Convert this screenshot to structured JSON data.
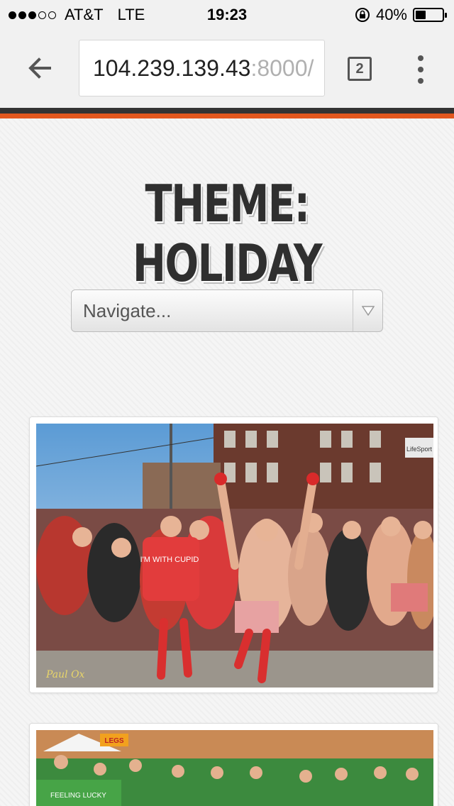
{
  "status_bar": {
    "carrier": "AT&T",
    "network": "LTE",
    "time": "19:23",
    "battery": "40%",
    "battery_level": 0.4
  },
  "browser": {
    "url_host": "104.239.139.43",
    "url_rest": ":8000/",
    "tab_count": "2",
    "icons": [
      "back-arrow-icon",
      "tabs-icon",
      "overflow-menu-icon"
    ]
  },
  "page": {
    "title": "THEME: HOLIDAY",
    "nav_select_value": "Navigate...",
    "photos": [
      {
        "shirt_text": "I'M WITH CUPID",
        "watermark": "Paul Ox",
        "sign": "LifeSport"
      },
      {
        "shirt_text": "FEELING LUCKY",
        "sign": "LEGS"
      }
    ]
  },
  "colors": {
    "accent_dark": "#333333",
    "accent_orange": "#e2571e"
  }
}
